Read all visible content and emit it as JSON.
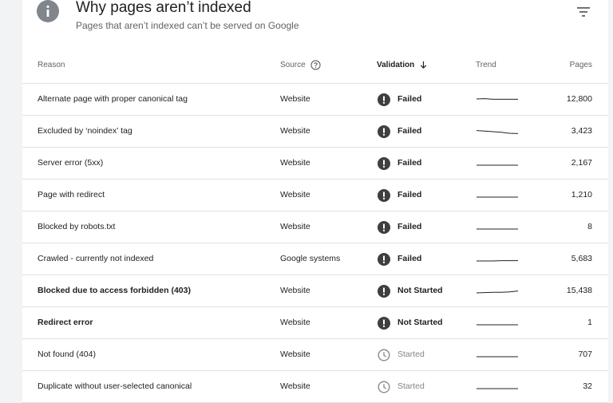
{
  "header": {
    "title": "Why pages aren’t indexed",
    "subtitle": "Pages that aren’t indexed can’t be served on Google",
    "icon": "info-icon",
    "filter_icon": "filter-icon"
  },
  "columns": {
    "reason": "Reason",
    "source": "Source",
    "validation": "Validation",
    "trend": "Trend",
    "pages": "Pages"
  },
  "rows": [
    {
      "reason": "Alternate page with proper canonical tag",
      "source": "Website",
      "validation": "Failed",
      "status": "failed",
      "pages": "12,800",
      "bold": false,
      "trend": [
        0.95,
        0.97,
        0.93,
        0.93,
        0.93,
        0.93
      ]
    },
    {
      "reason": "Excluded by ‘noindex’ tag",
      "source": "Website",
      "validation": "Failed",
      "status": "failed",
      "pages": "3,423",
      "bold": false,
      "trend": [
        0.97,
        0.94,
        0.9,
        0.86,
        0.8,
        0.78
      ]
    },
    {
      "reason": "Server error (5xx)",
      "source": "Website",
      "validation": "Failed",
      "status": "failed",
      "pages": "2,167",
      "bold": false,
      "trend": [
        0.8,
        0.8,
        0.8,
        0.8,
        0.8,
        0.8
      ]
    },
    {
      "reason": "Page with redirect",
      "source": "Website",
      "validation": "Failed",
      "status": "failed",
      "pages": "1,210",
      "bold": false,
      "trend": [
        0.8,
        0.8,
        0.8,
        0.8,
        0.8,
        0.8
      ]
    },
    {
      "reason": "Blocked by robots.txt",
      "source": "Website",
      "validation": "Failed",
      "status": "failed",
      "pages": "8",
      "bold": false,
      "trend": [
        0.8,
        0.8,
        0.8,
        0.8,
        0.8,
        0.8
      ]
    },
    {
      "reason": "Crawled - currently not indexed",
      "source": "Google systems",
      "validation": "Failed",
      "status": "failed",
      "pages": "5,683",
      "bold": false,
      "trend": [
        0.8,
        0.8,
        0.8,
        0.82,
        0.82,
        0.82
      ]
    },
    {
      "reason": "Blocked due to access forbidden (403)",
      "source": "Website",
      "validation": "Not Started",
      "status": "not-started",
      "pages": "15,438",
      "bold": true,
      "trend": [
        0.8,
        0.82,
        0.84,
        0.84,
        0.86,
        0.92
      ]
    },
    {
      "reason": "Redirect error",
      "source": "Website",
      "validation": "Not Started",
      "status": "not-started",
      "pages": "1",
      "bold": true,
      "trend": [
        0.8,
        0.8,
        0.8,
        0.8,
        0.8,
        0.8
      ]
    },
    {
      "reason": "Not found (404)",
      "source": "Website",
      "validation": "Started",
      "status": "started",
      "pages": "707",
      "bold": false,
      "trend": [
        0.8,
        0.8,
        0.8,
        0.8,
        0.8,
        0.8
      ]
    },
    {
      "reason": "Duplicate without user-selected canonical",
      "source": "Website",
      "validation": "Started",
      "status": "started",
      "pages": "32",
      "bold": false,
      "trend": [
        0.8,
        0.8,
        0.8,
        0.8,
        0.8,
        0.8
      ]
    }
  ],
  "colors": {
    "failed_icon": "#3c4043",
    "started_icon": "#80868b",
    "sparkline": "#202124"
  }
}
